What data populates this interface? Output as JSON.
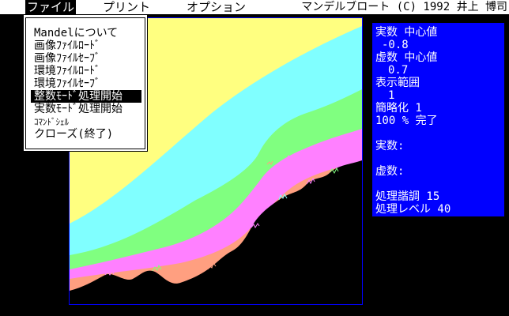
{
  "menubar": {
    "file": "ファイル",
    "print": "プリント",
    "option": "オプション",
    "copyright": "マンデルブロート (C) 1992 井上 博司"
  },
  "file_menu": {
    "items": [
      "Mandelについて",
      "画像ﾌｧｲﾙﾛｰﾄﾞ",
      "画像ﾌｧｲﾙｾｰﾌﾞ",
      "環境ﾌｧｲﾙﾛｰﾄﾞ",
      "環境ﾌｧｲﾙｾｰﾌﾞ",
      "整数ﾓｰﾄﾞ処理開始",
      "実数ﾓｰﾄﾞ処理開始",
      "ｺﾏﾝﾄﾞｼｪﾙ",
      "クローズ(終了)"
    ],
    "selected_index": 5
  },
  "info": {
    "real_center_label": "実数 中心値",
    "real_center_value": "-0.8",
    "imag_center_label": "虚数 中心値",
    "imag_center_value": "0.7",
    "range_label": "表示範囲",
    "range_value": "1",
    "simplify": "簡略化 1",
    "progress": "100 % 完了",
    "real_label": "実数:",
    "imag_label": "虚数:",
    "gradation": "処理諧調 15",
    "level": "処理レベル 40"
  },
  "colors": {
    "yellow": "#ffff80",
    "cyan": "#80ffff",
    "green": "#80ff80",
    "pink": "#ff80ff",
    "orange": "#ff9f80",
    "panel": "#0000ff"
  }
}
